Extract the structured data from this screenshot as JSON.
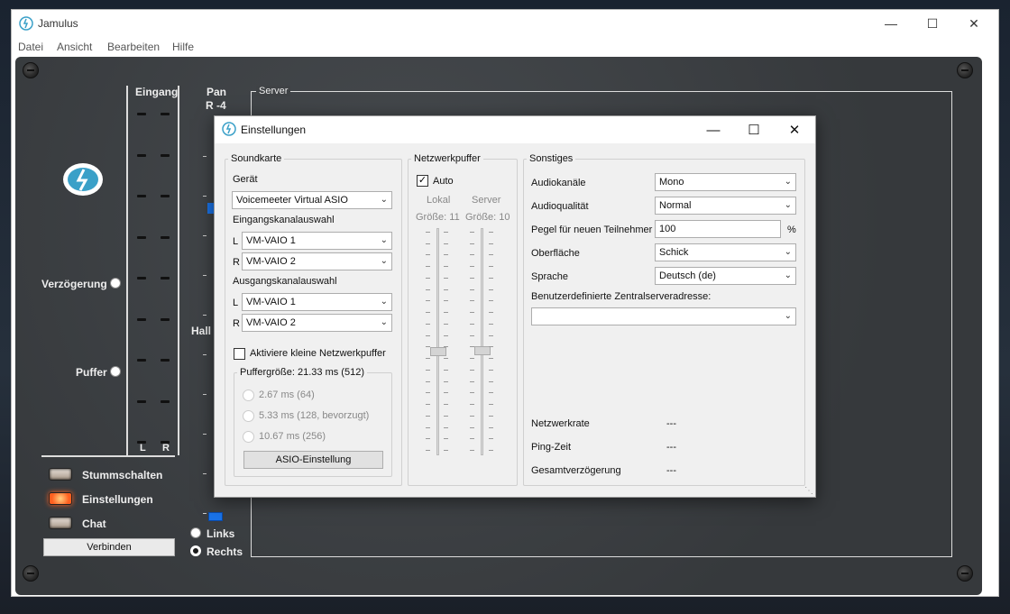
{
  "window": {
    "title": "Jamulus",
    "menu": [
      "Datei",
      "Ansicht",
      "Bearbeiten",
      "Hilfe"
    ]
  },
  "mixer": {
    "input_label": "Eingang",
    "meter_l": "L",
    "meter_r": "R",
    "pan_label": "Pan",
    "pan_value": "R -4",
    "reverb_label": "Hall",
    "delay_label": "Verzögerung",
    "buffer_label": "Puffer",
    "mute_label": "Stummschalten",
    "settings_label": "Einstellungen",
    "chat_label": "Chat",
    "connect_label": "Verbinden",
    "reverb_left": "Links",
    "reverb_right": "Rechts",
    "server_label": "Server"
  },
  "dialog": {
    "title": "Einstellungen",
    "soundcard": {
      "title": "Soundkarte",
      "device_label": "Gerät",
      "device_value": "Voicemeeter Virtual ASIO",
      "input_channel_label": "Eingangskanalauswahl",
      "input_l_prefix": "L",
      "input_l": "VM-VAIO 1",
      "input_r_prefix": "R",
      "input_r": "VM-VAIO 2",
      "output_channel_label": "Ausgangskanalauswahl",
      "output_l_prefix": "L",
      "output_l": "VM-VAIO 1",
      "output_r_prefix": "R",
      "output_r": "VM-VAIO 2",
      "small_buffers_label": "Aktiviere kleine Netzwerkpuffer",
      "buffer_size_title": "Puffergröße: 21.33 ms (512)",
      "buffer_options": [
        "2.67 ms (64)",
        "5.33 ms (128, bevorzugt)",
        "10.67 ms (256)"
      ],
      "asio_button": "ASIO-Einstellung"
    },
    "jitter": {
      "title": "Netzwerkpuffer",
      "auto_label": "Auto",
      "local_label": "Lokal",
      "server_label": "Server",
      "local_size": "Größe: 11",
      "server_size": "Größe: 10",
      "local_level": 0.45,
      "server_level": 0.5
    },
    "misc": {
      "title": "Sonstiges",
      "audio_channels_label": "Audiokanäle",
      "audio_channels_value": "Mono",
      "audio_quality_label": "Audioqualität",
      "audio_quality_value": "Normal",
      "new_client_level_label": "Pegel für neuen Teilnehmer",
      "new_client_level_value": "100",
      "new_client_level_unit": "%",
      "skin_label": "Oberfläche",
      "skin_value": "Schick",
      "language_label": "Sprache",
      "language_value": "Deutsch (de)",
      "custom_server_label": "Benutzerdefinierte Zentralserveradresse:",
      "custom_server_value": "",
      "net_rate_label": "Netzwerkrate",
      "net_rate_value": "---",
      "ping_label": "Ping-Zeit",
      "ping_value": "---",
      "delay_label": "Gesamtverzögerung",
      "delay_value": "---"
    }
  },
  "colors": {
    "panel": "#3a3d40",
    "accent_blue": "#1a73e8",
    "led_on": "#ff6020"
  }
}
